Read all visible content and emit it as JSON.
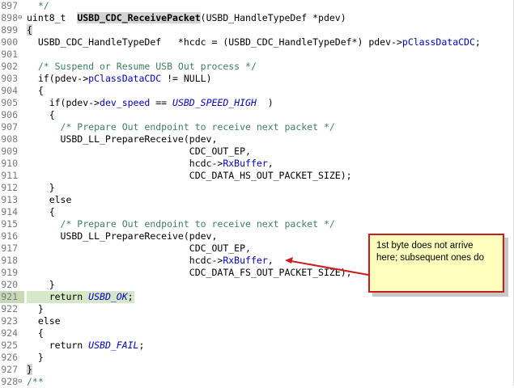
{
  "lines": [
    {
      "n": "897",
      "fold": "",
      "segs": [
        [
          "c",
          "  */"
        ]
      ]
    },
    {
      "n": "898",
      "fold": "⊖",
      "segs": [
        [
          "p",
          "uint8_t  "
        ],
        [
          "f",
          "USBD_CDC_ReceivePacket"
        ],
        [
          "p",
          "(USBD_HandleTypeDef *pdev)"
        ]
      ]
    },
    {
      "n": "899",
      "fold": "",
      "segs": [
        [
          "m",
          "{"
        ]
      ]
    },
    {
      "n": "900",
      "fold": "",
      "segs": [
        [
          "p",
          "  USBD_CDC_HandleTypeDef   *hcdc = (USBD_CDC_HandleTypeDef*) pdev->"
        ],
        [
          "v",
          "pClassDataCDC"
        ],
        [
          "p",
          ";"
        ]
      ]
    },
    {
      "n": "901",
      "fold": "",
      "segs": []
    },
    {
      "n": "902",
      "fold": "",
      "segs": [
        [
          "c",
          "  /* Suspend or Resume USB Out process */"
        ]
      ]
    },
    {
      "n": "903",
      "fold": "",
      "segs": [
        [
          "p",
          "  if(pdev->"
        ],
        [
          "v",
          "pClassDataCDC"
        ],
        [
          "p",
          " != NULL)"
        ]
      ]
    },
    {
      "n": "904",
      "fold": "",
      "segs": [
        [
          "p",
          "  {"
        ]
      ]
    },
    {
      "n": "905",
      "fold": "",
      "segs": [
        [
          "p",
          "    if(pdev->"
        ],
        [
          "v",
          "dev_speed"
        ],
        [
          "p",
          " == "
        ],
        [
          "e",
          "USBD_SPEED_HIGH"
        ],
        [
          "p",
          "  )"
        ]
      ]
    },
    {
      "n": "906",
      "fold": "",
      "segs": [
        [
          "p",
          "    {"
        ]
      ]
    },
    {
      "n": "907",
      "fold": "",
      "segs": [
        [
          "c",
          "      /* Prepare Out endpoint to receive next packet */"
        ]
      ]
    },
    {
      "n": "908",
      "fold": "",
      "segs": [
        [
          "p",
          "      USBD_LL_PrepareReceive(pdev,"
        ]
      ]
    },
    {
      "n": "909",
      "fold": "",
      "segs": [
        [
          "p",
          "                             CDC_OUT_EP,"
        ]
      ]
    },
    {
      "n": "910",
      "fold": "",
      "segs": [
        [
          "p",
          "                             hcdc->"
        ],
        [
          "v",
          "RxBuffer"
        ],
        [
          "p",
          ","
        ]
      ]
    },
    {
      "n": "911",
      "fold": "",
      "segs": [
        [
          "p",
          "                             CDC_DATA_HS_OUT_PACKET_SIZE);"
        ]
      ]
    },
    {
      "n": "912",
      "fold": "",
      "segs": [
        [
          "p",
          "    }"
        ]
      ]
    },
    {
      "n": "913",
      "fold": "",
      "segs": [
        [
          "p",
          "    else"
        ]
      ]
    },
    {
      "n": "914",
      "fold": "",
      "segs": [
        [
          "p",
          "    {"
        ]
      ]
    },
    {
      "n": "915",
      "fold": "",
      "segs": [
        [
          "c",
          "      /* Prepare Out endpoint to receive next packet */"
        ]
      ]
    },
    {
      "n": "916",
      "fold": "",
      "segs": [
        [
          "p",
          "      USBD_LL_PrepareReceive(pdev,"
        ]
      ]
    },
    {
      "n": "917",
      "fold": "",
      "segs": [
        [
          "p",
          "                             CDC_OUT_EP,"
        ]
      ]
    },
    {
      "n": "918",
      "fold": "",
      "segs": [
        [
          "p",
          "                             hcdc->"
        ],
        [
          "v",
          "RxBuffer"
        ],
        [
          "p",
          ","
        ]
      ]
    },
    {
      "n": "919",
      "fold": "",
      "segs": [
        [
          "p",
          "                             CDC_DATA_FS_OUT_PACKET_SIZE);"
        ]
      ]
    },
    {
      "n": "920",
      "fold": "",
      "segs": [
        [
          "p",
          "    }"
        ]
      ]
    },
    {
      "n": "921",
      "fold": "",
      "hl": true,
      "segs": [
        [
          "p",
          "    return "
        ],
        [
          "e",
          "USBD_OK"
        ],
        [
          "p",
          ";"
        ]
      ]
    },
    {
      "n": "922",
      "fold": "",
      "segs": [
        [
          "p",
          "  }"
        ]
      ]
    },
    {
      "n": "923",
      "fold": "",
      "segs": [
        [
          "p",
          "  else"
        ]
      ]
    },
    {
      "n": "924",
      "fold": "",
      "segs": [
        [
          "p",
          "  {"
        ]
      ]
    },
    {
      "n": "925",
      "fold": "",
      "segs": [
        [
          "p",
          "    return "
        ],
        [
          "e",
          "USBD_FAIL"
        ],
        [
          "p",
          ";"
        ]
      ]
    },
    {
      "n": "926",
      "fold": "",
      "segs": [
        [
          "p",
          "  }"
        ]
      ]
    },
    {
      "n": "927",
      "fold": "",
      "segs": [
        [
          "m",
          "}"
        ]
      ]
    },
    {
      "n": "928",
      "fold": "⊖",
      "segs": [
        [
          "c",
          "/**"
        ]
      ]
    }
  ],
  "callout": {
    "text": "1st byte does not arrive here; subsequent ones do",
    "border_color": "#c81e1e",
    "fill_color": "#ffffbe"
  }
}
